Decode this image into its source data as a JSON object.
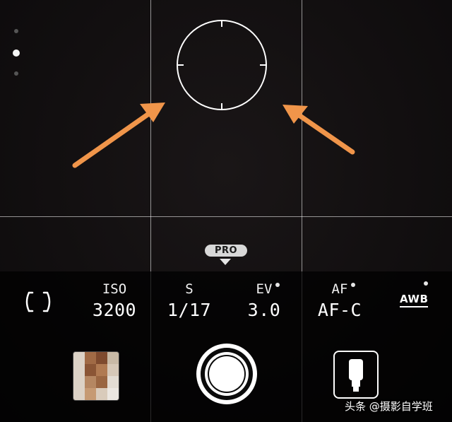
{
  "pro_badge": "PRO",
  "params": {
    "iso": {
      "label": "ISO",
      "value": "3200"
    },
    "shutter": {
      "label": "S",
      "value": "1/17"
    },
    "ev": {
      "label": "EV",
      "value": "3.0"
    },
    "af": {
      "label": "AF",
      "value": "AF-C"
    },
    "wb": {
      "label": "AWB"
    }
  },
  "icons": {
    "metering": "metering-center-weighted-icon",
    "focus_ring": "focus-circle-icon",
    "shutter": "shutter-button-icon",
    "mode_switch": "portrait-mode-icon"
  },
  "watermark": "头条 @摄影自学班",
  "colors": {
    "annotation_arrow": "#f0954a",
    "text": "#ffffff",
    "badge": "#d8d8d8"
  }
}
